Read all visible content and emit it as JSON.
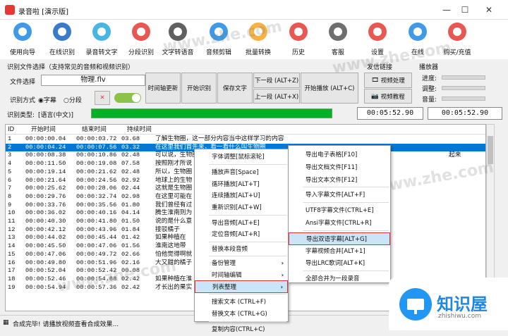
{
  "window": {
    "title": "录音啦 [演示版]",
    "minimize": "—",
    "maximize": "☐",
    "close": "✕"
  },
  "toolbar": [
    {
      "label": "使用向导",
      "icon": "cursor-icon",
      "color": "#1e88e5"
    },
    {
      "label": "在线识别",
      "icon": "microphone-icon",
      "color": "#1565c0"
    },
    {
      "label": "录音转文字",
      "icon": "w-letter-icon",
      "color": "#29a8e0"
    },
    {
      "label": "分段识别",
      "icon": "split-icon",
      "color": "#e53935"
    },
    {
      "label": "文字转语音",
      "icon": "text-speech-icon",
      "color": "#444444"
    },
    {
      "label": "音频剪辑",
      "icon": "scissors-icon",
      "color": "#1e88e5"
    },
    {
      "label": "批量转换",
      "icon": "folder-icon",
      "color": "#f5a623"
    },
    {
      "label": "历史",
      "icon": "history-icon",
      "color": "#e53935"
    },
    {
      "label": "客服",
      "icon": "service-icon",
      "color": "#555555"
    },
    {
      "label": "设置",
      "icon": "lifebuoy-icon",
      "color": "#e53935"
    },
    {
      "label": "在线",
      "icon": "user-icon",
      "color": "#1e88e5"
    },
    {
      "label": "购买/充值",
      "icon": "money-icon",
      "color": "#e53935"
    }
  ],
  "panel": {
    "section_label": "识别文件选择（支持常见的音频和视频识别）",
    "file_label": "文件选择",
    "file_value": "物理.flv",
    "mode_label": "识别方式",
    "mode_options": [
      "字幕",
      "分段"
    ],
    "mode_selected": "字幕",
    "type_label": "识别类型:",
    "type_value": "[语言(中文)]",
    "buttons": {
      "timeline": "时间轴更新",
      "start": "开始识别",
      "save": "保存文字",
      "next": "下一段 (ALT+Z)",
      "prev": "上一段 (ALT+X)",
      "play": "开始播放 (ALT+C)"
    },
    "tools_label": "发信链接",
    "video_process": "视频处理",
    "video_tutorial": "视频教程",
    "player_label": "播放器",
    "progress_label": "进度:",
    "adjust_label": "调整:",
    "volume_label": "音量:",
    "time_current": "00:05:52.90",
    "time_total": "00:05:52.90",
    "progress": 1.0
  },
  "table": {
    "headers": [
      "ID",
      "开始时间",
      "结束时间",
      "持续时间",
      ""
    ],
    "rows": [
      [
        "1",
        "00:00:00.04",
        "00:00:03.72",
        "03.68",
        "了解生物圈，这一部分内容当中这样学习的内容"
      ],
      [
        "2",
        "00:00:04.24",
        "00:00:07.56",
        "03.32",
        "在这里我们首先来，看一看什么叫生物圈"
      ],
      [
        "3",
        "00:00:08.38",
        "00:00:10.86",
        "02.48",
        "可以说，生物圈"
      ],
      [
        "4",
        "00:00:11.50",
        "00:00:19.08",
        "07.58",
        "按照刚才所说"
      ],
      [
        "5",
        "00:00:19.14",
        "00:00:21.62",
        "02.48",
        "所以，生物圈"
      ],
      [
        "6",
        "00:00:21.64",
        "00:00:24.56",
        "02.92",
        "地球上的生物"
      ],
      [
        "7",
        "00:00:25.62",
        "00:00:28.06",
        "02.44",
        "这就是生物圈"
      ],
      [
        "8",
        "00:00:29.76",
        "00:00:32.74",
        "02.98",
        "在这里可能在"
      ],
      [
        "9",
        "00:00:33.76",
        "00:00:35.56",
        "01.80",
        "我们曾经有过"
      ],
      [
        "10",
        "00:00:36.02",
        "00:00:40.16",
        "04.14",
        "腾生淮南则为"
      ],
      [
        "11",
        "00:00:40.30",
        "00:00:41.80",
        "01.50",
        "说的是什么意"
      ],
      [
        "12",
        "00:00:42.12",
        "00:00:43.96",
        "01.84",
        "接驳橘子"
      ],
      [
        "13",
        "00:00:44.02",
        "00:00:45.44",
        "01.42",
        "如果种植在"
      ],
      [
        "14",
        "00:00:45.50",
        "00:00:47.06",
        "01.56",
        "淮南这地带"
      ],
      [
        "15",
        "00:00:47.06",
        "00:00:49.72",
        "02.66",
        "怕他觉得啊就"
      ],
      [
        "16",
        "00:00:49.80",
        "00:00:51.96",
        "02.16",
        "大又甜的橘子"
      ],
      [
        "17",
        "00:00:52.04",
        "00:00:52.42",
        "00.08",
        ""
      ],
      [
        "18",
        "00:00:52.46",
        "00:00:54.88",
        "02.42",
        "如果种植在淮"
      ],
      [
        "19",
        "00:00:54.94",
        "00:00:57.36",
        "02.42",
        "才长出的果实"
      ]
    ],
    "row1_extra": "起来"
  },
  "context_menu": [
    {
      "label": "字体调整[鼠标滚轮]",
      "type": "item"
    },
    {
      "label": "播放声音[Space]",
      "type": "item"
    },
    {
      "label": "循环播放[ALT+T]",
      "type": "item"
    },
    {
      "label": "连续播放[ALT+U]",
      "type": "item"
    },
    {
      "label": "重新识别[ALT+W]",
      "type": "item"
    },
    {
      "label": "导出音频[ALT+E]",
      "type": "item"
    },
    {
      "label": "定位音频[ALT+R]",
      "type": "item"
    },
    {
      "label": "替换本段音频",
      "type": "item"
    },
    {
      "label": "备份管理",
      "type": "sub"
    },
    {
      "label": "时间轴编辑",
      "type": "sub"
    },
    {
      "label": "列表整理",
      "type": "sub-hl"
    },
    {
      "label": "搜索文本 (CTRL+F)",
      "type": "item"
    },
    {
      "label": "替换文本 (CTRL+G)",
      "type": "item"
    },
    {
      "label": "复制内容(CTRL+C)",
      "type": "item"
    }
  ],
  "submenu": [
    {
      "label": "导出电子表格[F10]",
      "hl": false
    },
    {
      "label": "导出文档文件[F11]",
      "hl": false
    },
    {
      "label": "导出文本文件[F12]",
      "hl": false
    },
    {
      "label": "导入字幕文件[ALT+F]",
      "hl": false
    },
    {
      "label": "UTF8字幕文件(CTRL+E]",
      "hl": false
    },
    {
      "label": "Ansi字幕文件[CTRL+R]",
      "hl": false
    },
    {
      "label": "导出双语字幕[ALT+G]",
      "hl": true
    },
    {
      "label": "字幕视频合并[ALT+1]",
      "hl": false
    },
    {
      "label": "导出LRC歌词[ALT+K]",
      "hl": false
    },
    {
      "label": "全部合并为一段录音",
      "hl": false
    }
  ],
  "status": {
    "message": "合成完毕! 请播放视频查看合成效果...",
    "right": "已导"
  },
  "watermark": {
    "text": "www.zhe.com",
    "logo_text": "知识屋",
    "logo_sub": "zhishiwu.com"
  }
}
